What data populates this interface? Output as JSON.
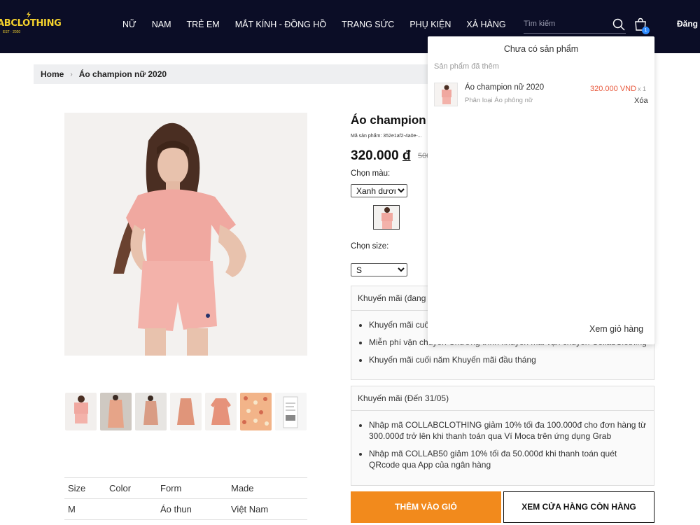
{
  "header": {
    "logo_text": "ABCLOTHING",
    "logo_sub": "EST · 2020",
    "nav": [
      "NỮ",
      "NAM",
      "TRẺ EM",
      "MẮT KÍNH - ĐỒNG HỒ",
      "TRANG SỨC",
      "PHỤ KIỆN",
      "XẢ HÀNG"
    ],
    "search_placeholder": "Tìm kiếm",
    "cart_count": "1",
    "login_label": "Đăng"
  },
  "breadcrumb": {
    "home": "Home",
    "current": "Áo champion nữ 2020"
  },
  "product": {
    "title": "Áo champion nữ 2020",
    "sku": "Mã sản phẩm: 352e1af2-4a0e-...",
    "price": "320.000",
    "currency": "đ",
    "old_price": "500.000 đ",
    "color_label": "Chọn màu:",
    "color_value": "Xanh dương",
    "size_label": "Chọn size:",
    "size_value": "S",
    "add_to_cart": "THÊM VÀO GIỎ",
    "view_store": "XEM CỬA HÀNG CÒN HÀNG"
  },
  "promo1": {
    "title": "Khuyến mãi (đang diễn ra)",
    "items": [
      "Khuyến mãi cuối năm Khuyến mãi đầu tháng",
      "Miễn phí vận chuyển Chương trình khuyến mãi vận chuyển CollabClothing",
      "Khuyến mãi cuối năm Khuyến mãi đầu tháng"
    ]
  },
  "promo2": {
    "title": "Khuyến mãi (Đến 31/05)",
    "items": [
      "Nhập mã COLLABCLOTHING giảm 10% tối đa 100.000đ cho đơn hàng từ 300.000đ trở lên khi thanh toán qua Ví Moca trên ứng dụng Grab",
      "Nhập mã COLLAB50 giảm 10% tối đa 50.000đ khi thanh toán quét QRcode qua App của ngân hàng"
    ]
  },
  "spec": {
    "headers": [
      "Size",
      "Color",
      "Form",
      "Made"
    ],
    "row": [
      "M",
      "",
      "Áo thun",
      "Việt Nam"
    ]
  },
  "cart_dropdown": {
    "title": "Chưa có sản phẩm",
    "subtitle": "Sản phẩm đã thêm",
    "item_name": "Áo champion nữ 2020",
    "item_category": "Phân loại Áo phông nữ",
    "item_price": "320.000 VND",
    "item_qty": "x 1",
    "delete_label": "Xóa",
    "view_cart": "Xem giỏ hàng"
  },
  "colors": {
    "header_bg": "#0b0d26",
    "logo": "#f6d32d",
    "add_button": "#f28a1c",
    "price_red": "#e8583c",
    "badge": "#2f8cff"
  },
  "icons": {
    "search": "search-icon",
    "cart": "cart-icon"
  }
}
